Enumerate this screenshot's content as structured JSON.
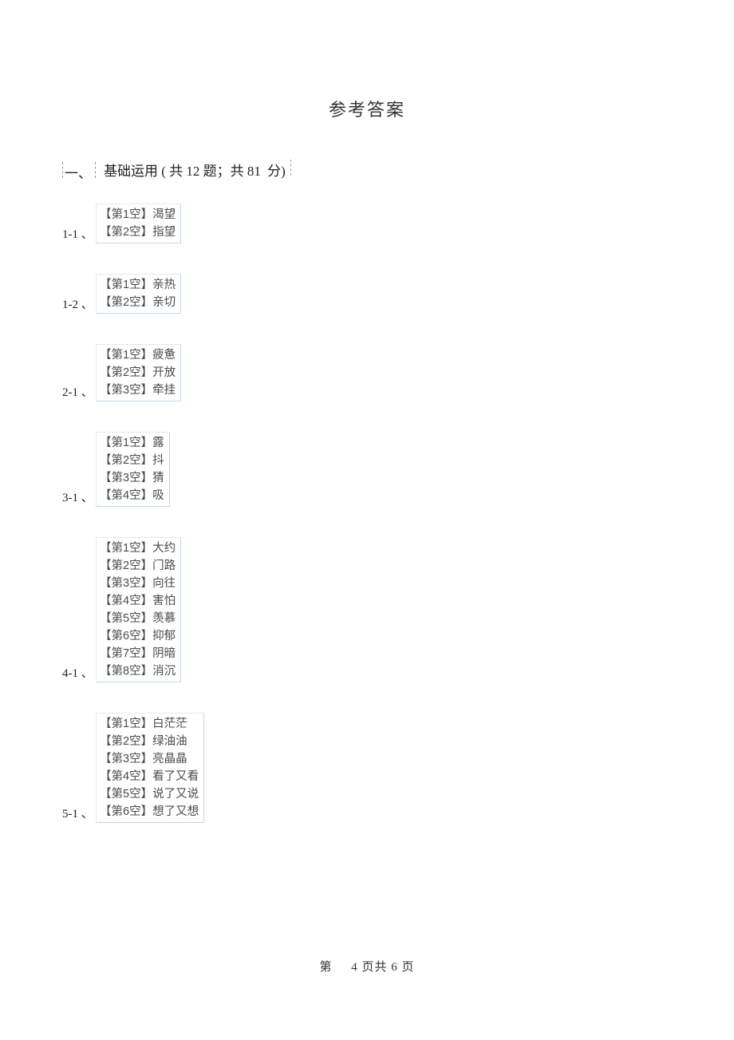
{
  "title": "参考答案",
  "section": {
    "number": "一、",
    "label": "基础运用",
    "detail_prefix": "( 共",
    "detail_count": "12",
    "detail_mid": "题；共",
    "detail_score": "81",
    "detail_suffix": "分)"
  },
  "groups": [
    {
      "qnum": "1-1 、",
      "lines": [
        "【第1空】渴望",
        "【第2空】指望"
      ]
    },
    {
      "qnum": "1-2 、",
      "lines": [
        "【第1空】亲热",
        "【第2空】亲切"
      ]
    },
    {
      "qnum": "2-1 、",
      "lines": [
        "【第1空】疲惫",
        "【第2空】开放",
        "【第3空】牵挂"
      ]
    },
    {
      "qnum": "3-1 、",
      "lines": [
        "【第1空】露",
        "【第2空】抖",
        "【第3空】猜",
        "【第4空】吸"
      ]
    },
    {
      "qnum": "4-1 、",
      "lines": [
        "【第1空】大约",
        "【第2空】门路",
        "【第3空】向往",
        "【第4空】害怕",
        "【第5空】羡慕",
        "【第6空】抑郁",
        "【第7空】阴暗",
        "【第8空】消沉"
      ]
    },
    {
      "qnum": "5-1 、",
      "lines": [
        "【第1空】白茫茫",
        "【第2空】绿油油",
        "【第3空】亮晶晶",
        "【第4空】看了又看",
        "【第5空】说了又说",
        "【第6空】想了又想"
      ]
    }
  ],
  "footer": {
    "prefix": "第",
    "page": "4",
    "mid": "页共",
    "total": "6",
    "suffix": "页"
  }
}
